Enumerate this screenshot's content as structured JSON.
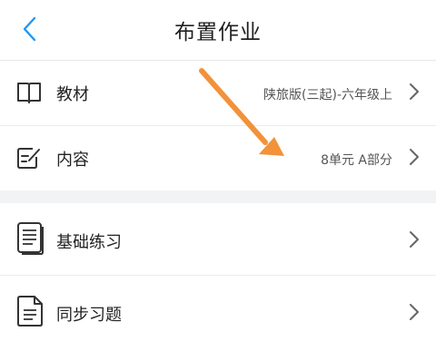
{
  "header": {
    "title": "布置作业",
    "back_icon": "chevron-left-icon",
    "accent": "#2196f3"
  },
  "settings": {
    "textbook": {
      "label": "教材",
      "value": "陕旅版(三起)-六年级上",
      "icon": "book-icon"
    },
    "content": {
      "label": "内容",
      "value": "8单元 A部分",
      "icon": "edit-icon"
    }
  },
  "exercises": {
    "basic": {
      "label": "基础练习",
      "icon": "document-stack-icon"
    },
    "sync": {
      "label": "同步习题",
      "icon": "document-icon"
    }
  },
  "annotation": {
    "color": "#f2923a"
  }
}
